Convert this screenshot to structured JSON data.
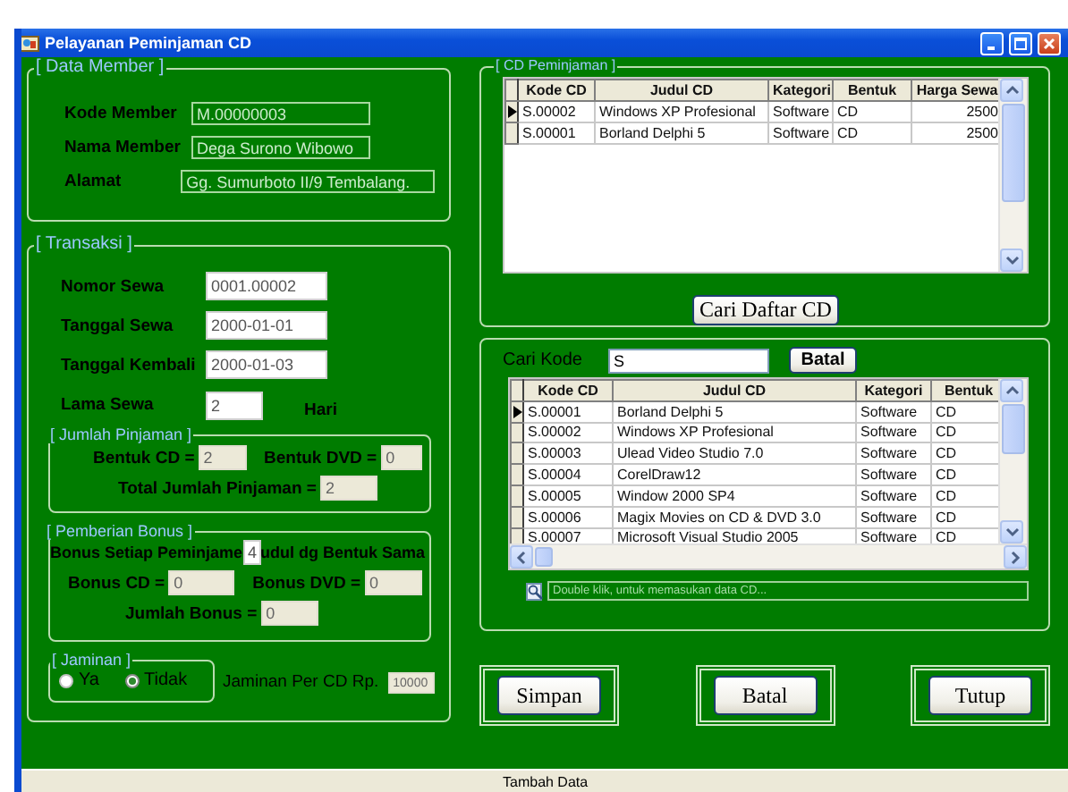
{
  "window": {
    "title": "Pelayanan Peminjaman CD"
  },
  "member": {
    "title": "[ Data Member ]",
    "fields": [
      {
        "label": "Kode Member",
        "value": "M.00000003",
        "kind": "short"
      },
      {
        "label": "Nama Member",
        "value": "Dega Surono Wibowo",
        "kind": "short"
      },
      {
        "label": "Alamat",
        "value": "Gg. Sumurboto II/9 Tembalang.",
        "kind": "long"
      }
    ]
  },
  "transaksi": {
    "title": "[ Transaksi ]",
    "fields": [
      {
        "label": "Nomor Sewa",
        "value": "0001.00002",
        "kind": "date"
      },
      {
        "label": "Tanggal Sewa",
        "value": "2000-01-01",
        "kind": "date"
      },
      {
        "label": "Tanggal Kembali",
        "value": "2000-01-03",
        "kind": "date"
      },
      {
        "label": "Lama Sewa",
        "value": "2",
        "kind": "days",
        "unit": "Hari"
      }
    ],
    "jumlah": {
      "title": "[ Jumlah Pinjaman ]",
      "cd_label": "Bentuk CD =",
      "cd_value": "2",
      "dvd_label": "Bentuk DVD =",
      "dvd_value": "0",
      "total_label": "Total Jumlah Pinjaman =",
      "total_value": "2"
    },
    "bonus": {
      "title": "[ Pemberian Bonus ]",
      "rule_before": "Bonus Setiap Peminjame",
      "rule_value": "4",
      "rule_after": "udul dg Bentuk Sama",
      "cd_label": "Bonus CD =",
      "cd_value": "0",
      "dvd_label": "Bonus DVD =",
      "dvd_value": "0",
      "total_label": "Jumlah Bonus =",
      "total_value": "0"
    },
    "jaminan": {
      "title": "[ Jaminan ]",
      "options": [
        {
          "label": "Ya",
          "selected": false
        },
        {
          "label": "Tidak",
          "selected": true
        }
      ],
      "label": "Jaminan Per CD Rp.",
      "value": "10000"
    }
  },
  "peminjaman": {
    "title": "[ CD Peminjaman ]",
    "table": {
      "columns": [
        "Kode CD",
        "Judul CD",
        "Kategori",
        "Bentuk",
        "Harga Sewa"
      ],
      "rows": [
        {
          "cells": [
            "S.00002",
            "Windows XP Profesional",
            "Software",
            "CD",
            "2500"
          ],
          "selected": true
        },
        {
          "cells": [
            "S.00001",
            "Borland Delphi 5",
            "Software",
            "CD",
            "2500"
          ],
          "selected": false
        }
      ]
    },
    "button": "Cari Daftar CD"
  },
  "search": {
    "label": "Cari Kode",
    "value": "S",
    "button": "Batal",
    "table": {
      "columns": [
        "Kode CD",
        "Judul CD",
        "Kategori",
        "Bentuk"
      ],
      "rows": [
        {
          "cells": [
            "S.00001",
            "Borland Delphi 5",
            "Software",
            "CD"
          ],
          "selected": true
        },
        {
          "cells": [
            "S.00002",
            "Windows XP Profesional",
            "Software",
            "CD"
          ],
          "selected": false
        },
        {
          "cells": [
            "S.00003",
            "Ulead Video Studio 7.0",
            "Software",
            "CD"
          ],
          "selected": false
        },
        {
          "cells": [
            "S.00004",
            "CorelDraw12",
            "Software",
            "CD"
          ],
          "selected": false
        },
        {
          "cells": [
            "S.00005",
            "Window 2000 SP4",
            "Software",
            "CD"
          ],
          "selected": false
        },
        {
          "cells": [
            "S.00006",
            "Magix Movies on CD & DVD 3.0",
            "Software",
            "CD"
          ],
          "selected": false
        },
        {
          "cells": [
            "S.00007",
            "Microsoft Visual Studio 2005",
            "Software",
            "CD"
          ],
          "selected": false
        }
      ]
    },
    "hint": "Double klik, untuk memasukan data CD..."
  },
  "buttons": [
    {
      "label": "Simpan"
    },
    {
      "label": "Batal"
    },
    {
      "label": "Tutup"
    }
  ],
  "status_bar": "Tambah Data"
}
